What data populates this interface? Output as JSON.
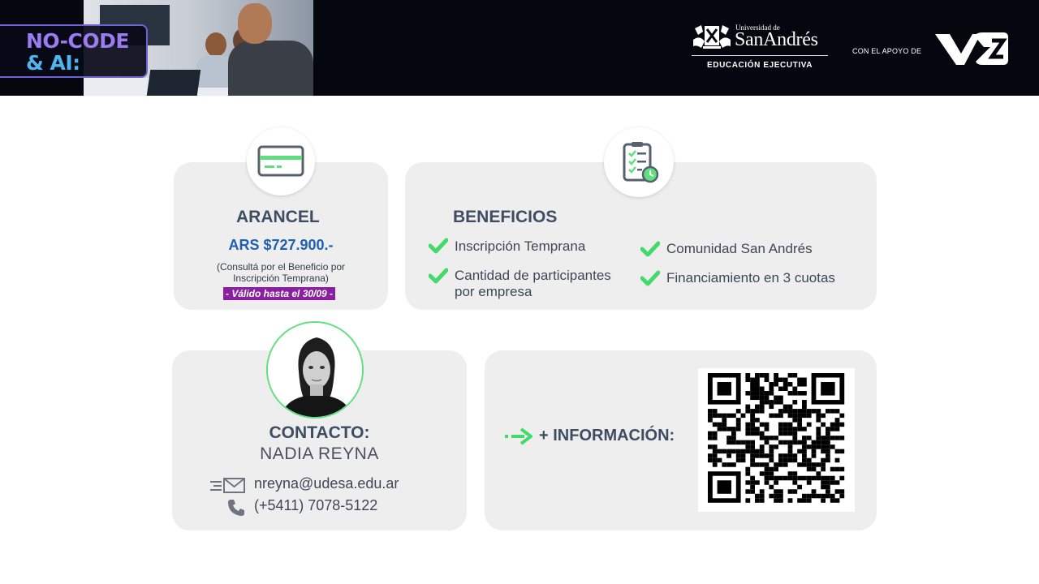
{
  "header": {
    "badge_line1": "NO-CODE",
    "badge_line2": "& AI:",
    "university_small": "Universidad de",
    "university_name": "SanAndrés",
    "university_unit": "EDUCACIÓN EJECUTIVA",
    "support_text": "CON EL APOYO DE",
    "partner_logo": "VT"
  },
  "arancel": {
    "icon": "credit-card-icon",
    "title": "ARANCEL",
    "price": "ARS $727.900.-",
    "note_line1": "(Consultá por el Beneficio por",
    "note_line2": "Inscripción Temprana)",
    "valid_badge": "- Válido hasta el 30/09 -"
  },
  "beneficios": {
    "icon": "checklist-clock-icon",
    "title": "BENEFICIOS",
    "items": [
      {
        "line1": "Inscripción Temprana",
        "line2": ""
      },
      {
        "line1": "Cantidad de participantes",
        "line2": "por empresa"
      },
      {
        "line1": "Comunidad San Andrés",
        "line2": ""
      },
      {
        "line1": "Financiamiento en 3 cuotas",
        "line2": ""
      }
    ]
  },
  "contacto": {
    "title": "CONTACTO:",
    "name": "NADIA REYNA",
    "email": "nreyna@udesa.edu.ar",
    "phone": "(+5411) 7078-5122"
  },
  "info": {
    "label": "+ INFORMACIÓN:",
    "qr_icon": "qr-code"
  },
  "colors": {
    "header_bg": "#04070e",
    "card_bg": "#eeeeee",
    "accent_green": "#43d96b",
    "price_blue": "#1f5fb4",
    "badge_purple": "#8a1fa0"
  }
}
